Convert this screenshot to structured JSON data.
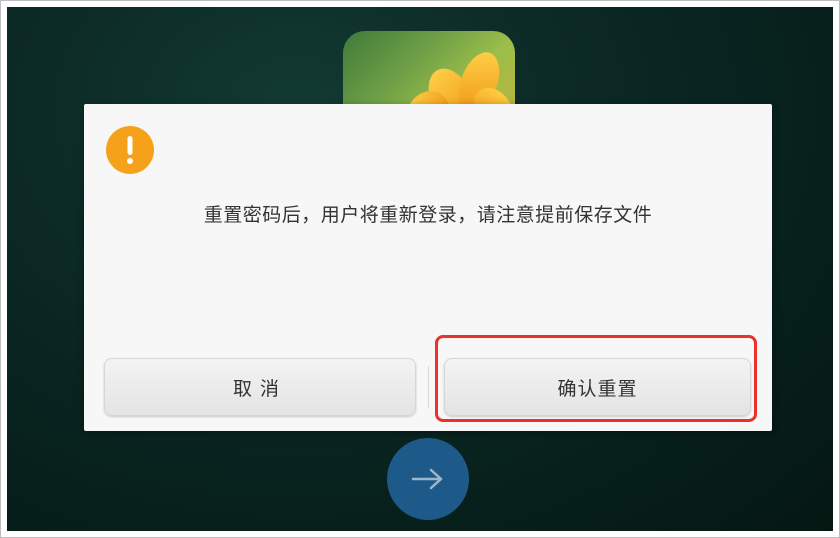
{
  "dialog": {
    "message": "重置密码后，用户将重新登录，请注意提前保存文件",
    "cancel_label": "取消",
    "confirm_label": "确认重置"
  },
  "icons": {
    "warning": "warning-icon",
    "next": "arrow-right-icon"
  },
  "colors": {
    "warning": "#f5a21a",
    "highlight": "#e8322b",
    "next_button": "#1d5a8a"
  }
}
